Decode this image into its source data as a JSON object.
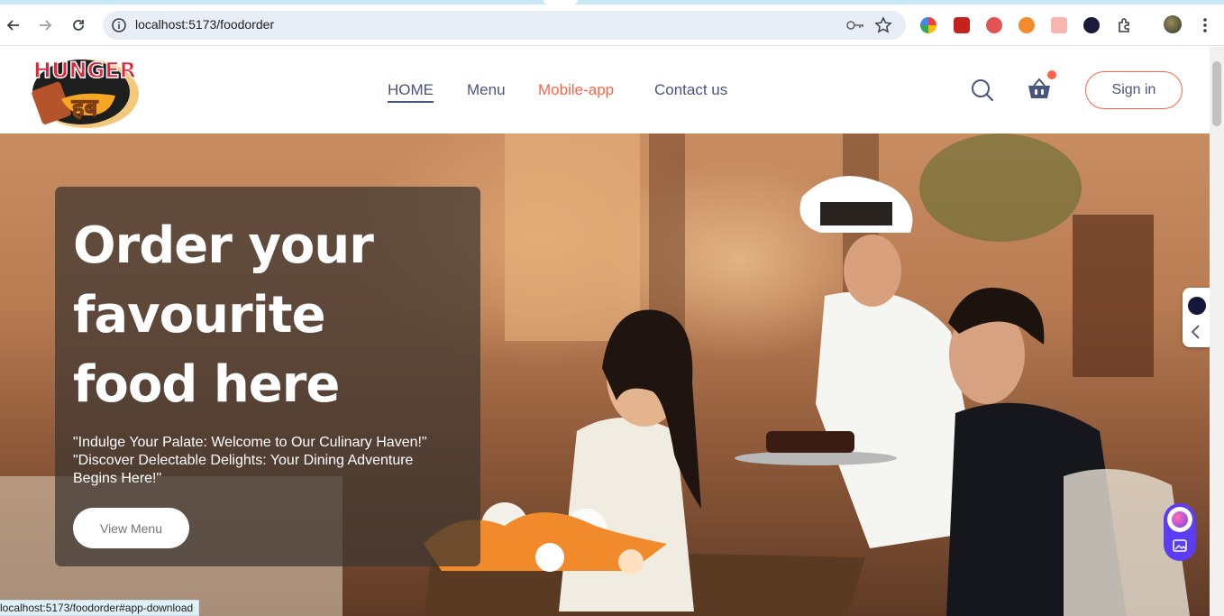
{
  "browser": {
    "url": "localhost:5173/foodorder",
    "status_url": "localhost:5173/foodorder#app-download"
  },
  "site": {
    "logo": {
      "text_top": "HUNGER",
      "text_bottom": "हब"
    },
    "nav": [
      {
        "label": "HOME"
      },
      {
        "label": "Menu"
      },
      {
        "label": "Mobile-app"
      },
      {
        "label": "Contact us"
      }
    ],
    "signin_label": "Sign in"
  },
  "hero": {
    "title": "Order your favourite food here",
    "subtitle_line1": "\"Indulge Your Palate: Welcome to Our Culinary Haven!\"",
    "subtitle_line2": "\"Discover Delectable Delights: Your Dining Adventure Begins Here!\"",
    "button_label": "View Menu"
  },
  "colors": {
    "accent": "#ff6347",
    "nav_text": "#49557e",
    "hero_panel": "#3c3430"
  },
  "icons": [
    "back-icon",
    "forward-icon",
    "reload-icon",
    "info-icon",
    "password-key-icon",
    "bookmark-star-icon",
    "extensions-icon",
    "profile-avatar",
    "menu-dots-icon",
    "search-icon",
    "basket-icon",
    "chevron-left-icon"
  ]
}
